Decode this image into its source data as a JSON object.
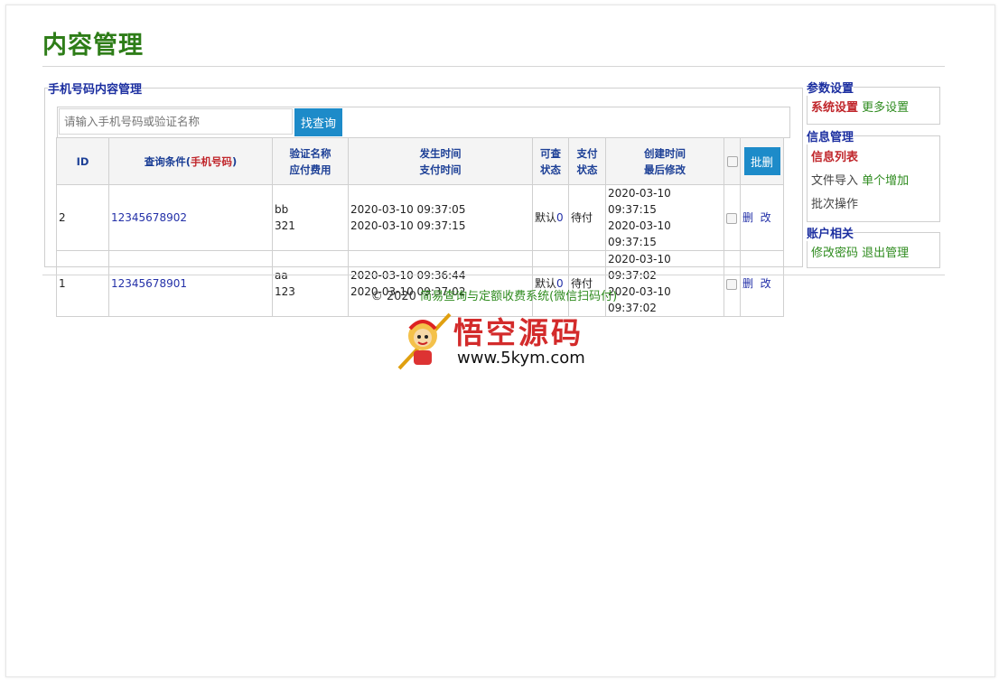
{
  "page": {
    "title": "内容管理"
  },
  "main": {
    "legend": "手机号码内容管理",
    "search": {
      "placeholder": "请输入手机号码或验证名称",
      "button": "找查询"
    },
    "table": {
      "headers": {
        "id": "ID",
        "cond_prefix": "查询条件(",
        "cond_mid": "手机号码",
        "cond_suffix": ")",
        "verify1": "验证名称",
        "verify2": "应付费用",
        "time1": "发生时间",
        "time2": "支付时间",
        "view1": "可查",
        "view2": "状态",
        "pay1": "支付",
        "pay2": "状态",
        "create1": "创建时间",
        "create2": "最后修改",
        "batch_delete": "批删"
      },
      "rows": [
        {
          "id": "2",
          "phone": "12345678902",
          "name": "bb",
          "fee": "321",
          "occur": "2020-03-10 09:37:05",
          "paid": "2020-03-10 09:37:15",
          "view_prefix": "默认",
          "view_count": "0",
          "pay_status": "待付",
          "created": "2020-03-10 09:37:15",
          "modified": "2020-03-10 09:37:15",
          "delete": "删",
          "edit": "改"
        },
        {
          "id": "1",
          "phone": "12345678901",
          "name": "aa",
          "fee": "123",
          "occur": "2020-03-10 09:36:44",
          "paid": "2020-03-10 09:37:02",
          "view_prefix": "默认",
          "view_count": "0",
          "pay_status": "待付",
          "created": "2020-03-10 09:37:02",
          "modified": "2020-03-10 09:37:02",
          "delete": "删",
          "edit": "改"
        }
      ]
    }
  },
  "sidebar": {
    "params": {
      "legend": "参数设置",
      "system": "系统设置",
      "more": "更多设置"
    },
    "info": {
      "legend": "信息管理",
      "list": "信息列表",
      "import": "文件导入",
      "add_single": "单个增加",
      "batch": "批次操作"
    },
    "account": {
      "legend": "账户相关",
      "change_pwd": "修改密码",
      "logout": "退出管理"
    }
  },
  "footer": {
    "copyright": "© 2020",
    "site": "简易查询与定额收费系统(微信扫码付)"
  },
  "logo": {
    "text": "悟空源码",
    "url": "www.5kym.com"
  },
  "colors": {
    "brand_green": "#2e7d18",
    "button_blue": "#1d8bc9",
    "legend_blue": "#1c2fa0",
    "accent_red": "#c0262b"
  }
}
